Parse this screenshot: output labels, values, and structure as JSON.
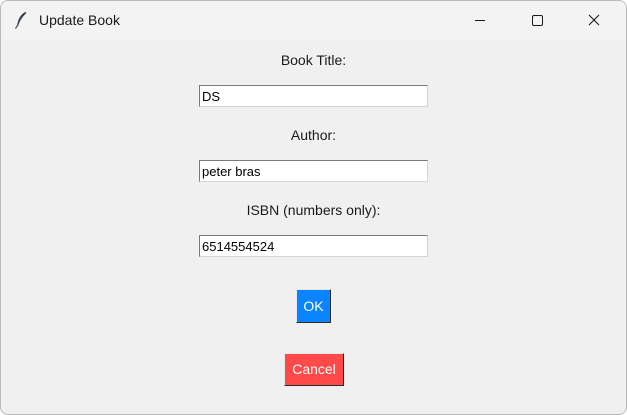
{
  "window": {
    "title": "Update Book",
    "icon": "feather-icon",
    "controls": [
      "minimize-icon",
      "maximize-icon",
      "close-icon"
    ]
  },
  "form": {
    "title_label": "Book Title:",
    "title_value": "DS",
    "author_label": "Author:",
    "author_value": "peter bras",
    "isbn_label": "ISBN (numbers only):",
    "isbn_value": "6514554524"
  },
  "buttons": {
    "ok_label": "OK",
    "ok_color": "#0a84ff",
    "cancel_label": "Cancel",
    "cancel_color": "#ff4a4a"
  }
}
